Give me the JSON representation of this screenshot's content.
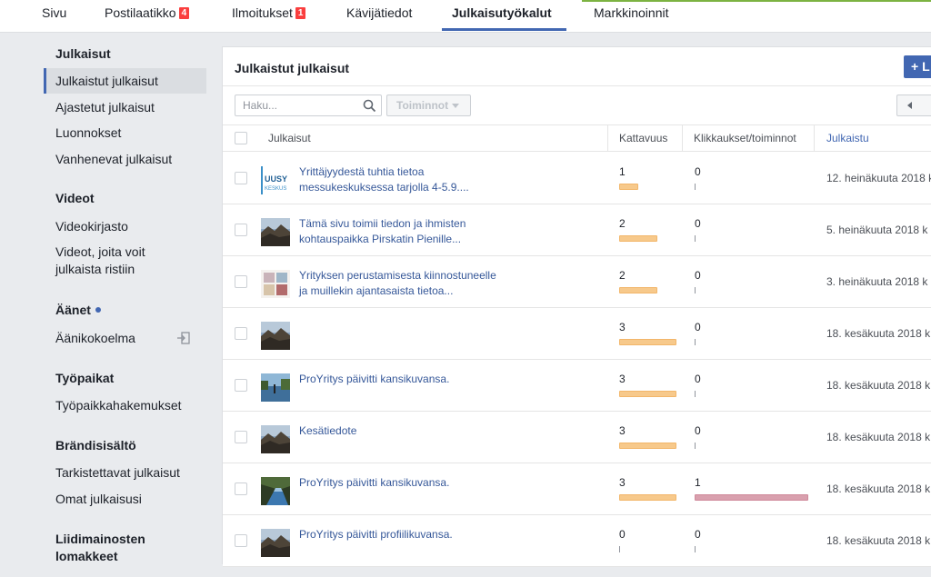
{
  "topnav": {
    "tabs": [
      {
        "label": "Sivu"
      },
      {
        "label": "Postilaatikko",
        "badge": "4"
      },
      {
        "label": "Ilmoitukset",
        "badge": "1"
      },
      {
        "label": "Kävijätiedot"
      },
      {
        "label": "Julkaisutyökalut"
      },
      {
        "label": "Markkinoinnit"
      }
    ],
    "active_tab": "Julkaisutyökalut"
  },
  "sidebar": {
    "sections": [
      {
        "heading": "Julkaisut",
        "items": [
          "Julkaistut julkaisut",
          "Ajastetut julkaisut",
          "Luonnokset",
          "Vanhenevat julkaisut"
        ]
      },
      {
        "heading": "Videot",
        "items": [
          "Videokirjasto",
          "Videot, joita voit julkaista ristiin"
        ]
      },
      {
        "heading": "Äänet",
        "items": [
          "Äänikokoelma"
        ]
      },
      {
        "heading": "Työpaikat",
        "items": [
          "Työpaikkahakemukset"
        ]
      },
      {
        "heading": "Brändisisältö",
        "items": [
          "Tarkistettavat julkaisut",
          "Omat julkaisusi"
        ]
      },
      {
        "heading": "Liidimainosten lomakkeet",
        "items": []
      }
    ],
    "active_item": "Julkaistut julkaisut"
  },
  "panel": {
    "title": "Julkaistut julkaisut",
    "create_label": "+ L",
    "search_placeholder": "Haku...",
    "actions_label": "Toiminnot",
    "columns": [
      "Julkaisut",
      "Kattavuus",
      "Klikkaukset/toiminnot",
      "Julkaistu"
    ],
    "sorted_column": "Julkaistu"
  },
  "rows": [
    {
      "thumb": "logo",
      "logo_text_1": "UUSY",
      "logo_text_2": "KESKUS",
      "text": "Yrittäjyydestä tuhtia tietoa messukeskuksessa tarjolla 4-5.9....",
      "reach": 1,
      "clicks": 0,
      "date": "12. heinäkuuta 2018 k"
    },
    {
      "thumb": "photo-rock",
      "text": "Tämä sivu toimii tiedon ja ihmisten kohtauspaikka Pirskatin Pienille...",
      "reach": 2,
      "clicks": 0,
      "date": "5. heinäkuuta 2018 k"
    },
    {
      "thumb": "photo-collage",
      "text": "Yrityksen perustamisesta kiinnostuneelle ja muillekin ajantasaista tietoa...",
      "reach": 2,
      "clicks": 0,
      "date": "3. heinäkuuta 2018 k"
    },
    {
      "thumb": "photo-rock",
      "text": "",
      "reach": 3,
      "clicks": 0,
      "date": "18. kesäkuuta 2018 k"
    },
    {
      "thumb": "photo-lake",
      "text": "ProYritys päivitti kansikuvansa.",
      "reach": 3,
      "clicks": 0,
      "date": "18. kesäkuuta 2018 k"
    },
    {
      "thumb": "photo-rock",
      "text": "Kesätiedote",
      "reach": 3,
      "clicks": 0,
      "date": "18. kesäkuuta 2018 k"
    },
    {
      "thumb": "photo-lake2",
      "text": "ProYritys päivitti kansikuvansa.",
      "reach": 3,
      "clicks": 1,
      "date": "18. kesäkuuta 2018 k"
    },
    {
      "thumb": "photo-rock",
      "text": "ProYritys päivitti profiilikuvansa.",
      "reach": 0,
      "clicks": 0,
      "date": "18. kesäkuuta 2018 k"
    }
  ],
  "colors": {
    "accent": "#4267b2",
    "link": "#365899",
    "reach_bar": "#f7c98b",
    "click_bar": "#d9a0ae",
    "badge": "#fa3e3e"
  }
}
